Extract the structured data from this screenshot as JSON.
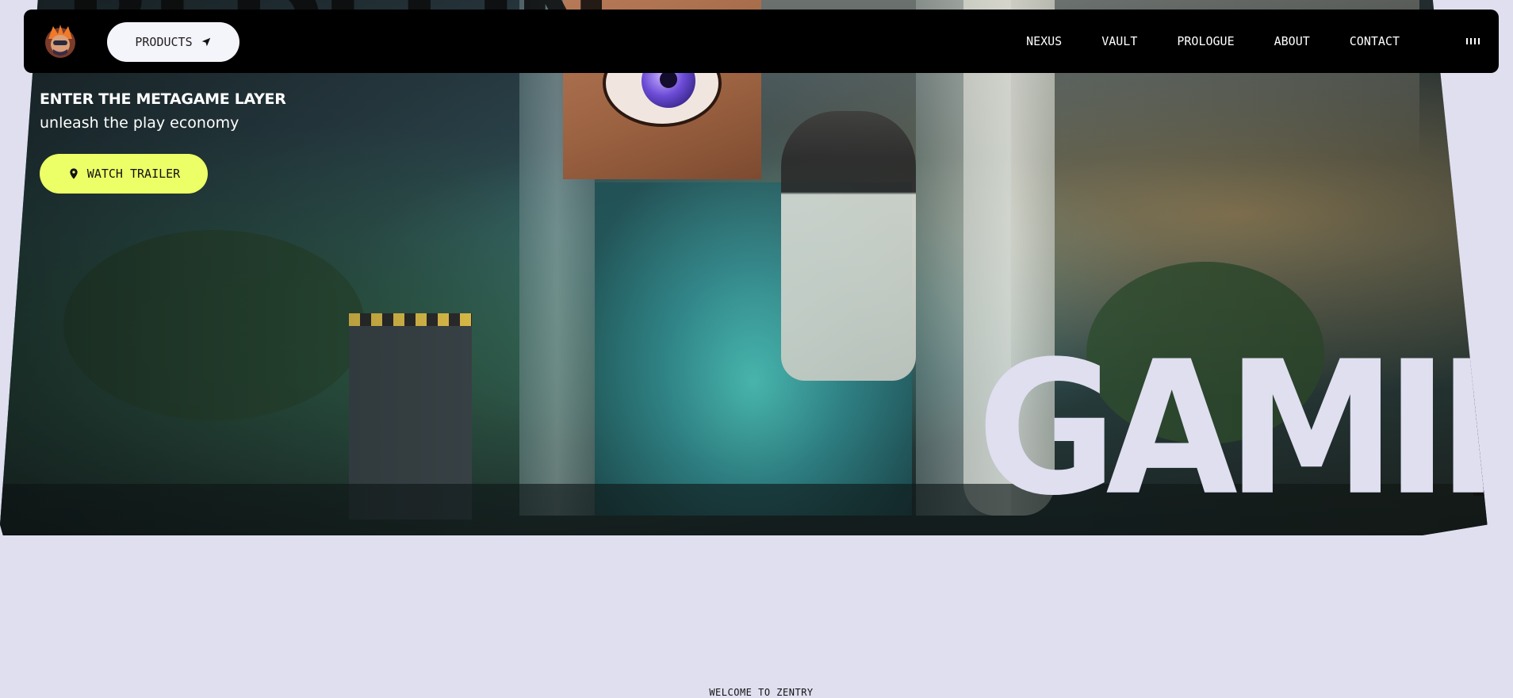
{
  "nav": {
    "products_label": "PRODUCTS",
    "links": [
      "NEXUS",
      "VAULT",
      "PROLOGUE",
      "ABOUT",
      "CONTACT"
    ]
  },
  "hero": {
    "tagline_line1": "ENTER THE METAGAME LAYER",
    "tagline_line2": "unleash the play economy",
    "watch_label": "WATCH TRAILER",
    "big_word": "GAMING",
    "top_word": "REDEFIN"
  },
  "footer": {
    "welcome": "WELCOME TO ZENTRY"
  },
  "colors": {
    "background": "#dfdff0",
    "accent": "#edff66",
    "nav_bg": "#000000"
  },
  "icons": [
    "logo-icon",
    "navigation-arrow-icon",
    "location-pin-icon",
    "audio-bars-icon"
  ]
}
